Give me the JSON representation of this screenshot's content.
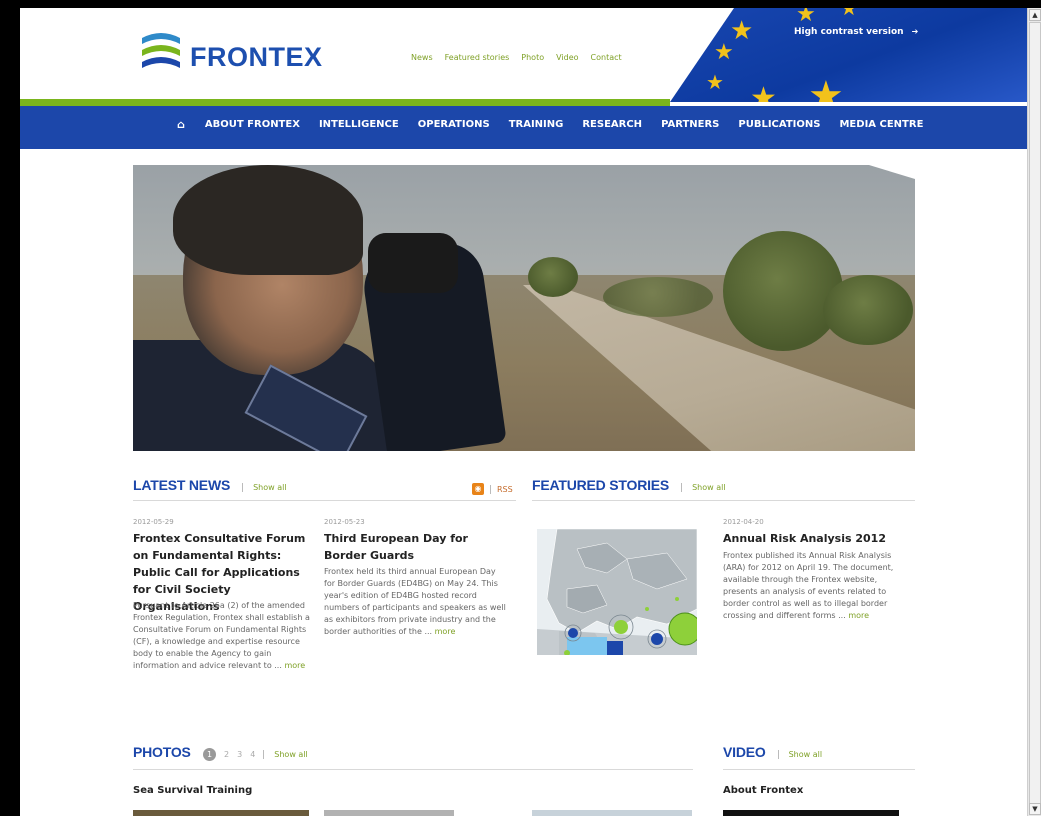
{
  "header": {
    "logo_text": "FRONTEX",
    "high_contrast": "High contrast version",
    "top_links": [
      "News",
      "Featured stories",
      "Photo",
      "Video",
      "Contact"
    ]
  },
  "nav": {
    "home_icon": "home-icon",
    "items": [
      "ABOUT FRONTEX",
      "INTELLIGENCE",
      "OPERATIONS",
      "TRAINING",
      "RESEARCH",
      "PARTNERS",
      "PUBLICATIONS",
      "MEDIA CENTRE"
    ]
  },
  "latest_news": {
    "title": "LATEST NEWS",
    "show_all": "Show all",
    "rss": "RSS",
    "items": [
      {
        "date": "2012-05-29",
        "headline": "Frontex Consultative Forum on Fundamental Rights: Public Call for Applications for Civil Society Organisations",
        "body": "Pursuant to Article 26a (2) of the amended Frontex Regulation, Frontex shall establish a Consultative Forum on Fundamental Rights (CF), a knowledge and expertise resource body to enable the Agency to gain information and advice relevant to ...",
        "more": "more"
      },
      {
        "date": "2012-05-23",
        "headline": "Third European Day for Border Guards",
        "body": "Frontex held its third annual European Day for Border Guards (ED4BG) on May 24. This year's edition of ED4BG hosted record numbers of participants and speakers as well as exhibitors from private industry and the border authorities of the ...",
        "more": "more"
      }
    ]
  },
  "featured_stories": {
    "title": "FEATURED STORIES",
    "show_all": "Show all",
    "item": {
      "date": "2012-04-20",
      "headline": "Annual Risk Analysis 2012",
      "body": "Frontex published its Annual Risk Analysis (ARA) for 2012 on April 19. The document, available through the Frontex website, presents an analysis of events related to border control as well as to illegal border crossing and different forms ...",
      "more": "more"
    }
  },
  "photos": {
    "title": "PHOTOS",
    "pages": [
      "1",
      "2",
      "3",
      "4"
    ],
    "show_all": "Show all",
    "album_title": "Sea Survival Training"
  },
  "video": {
    "title": "VIDEO",
    "show_all": "Show all",
    "video_title": "About Frontex"
  },
  "colors": {
    "brand_blue": "#1c47aa",
    "accent_green": "#7ab51d",
    "link_green": "#7fa127",
    "eu_star": "#f2c21b"
  }
}
